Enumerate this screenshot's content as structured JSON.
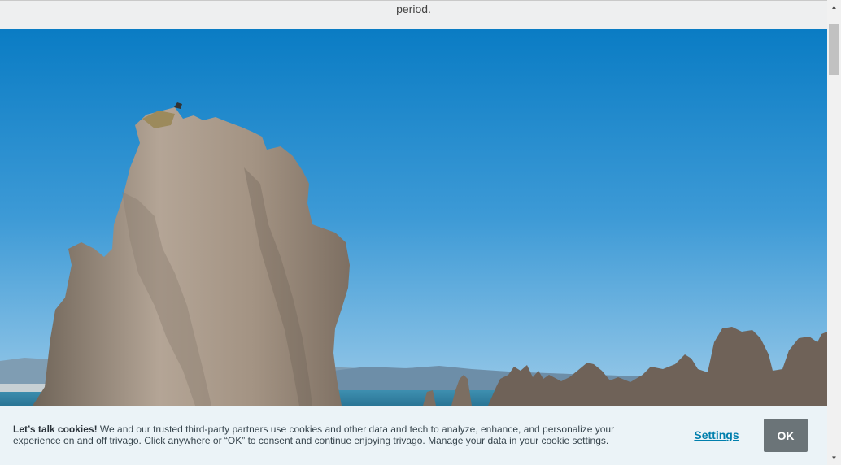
{
  "top_band": {
    "text": "period."
  },
  "hero_image": {
    "description_icon": "photo-tufa-towers"
  },
  "cookie_banner": {
    "heading": "Let’s talk cookies!",
    "body": " We and our trusted third-party partners use cookies and other data and tech to analyze, enhance, and personalize your experience on and off trivago. Click anywhere or “OK” to consent and continue enjoying trivago. Manage your data in your cookie settings.",
    "settings_label": "Settings",
    "ok_label": "OK",
    "colors": {
      "background": "#ebf3f7",
      "link": "#007fad",
      "button": "#6b7478"
    }
  },
  "scrollbar": {
    "up_icon": "scroll-up-arrow-icon",
    "down_icon": "scroll-down-arrow-icon"
  }
}
